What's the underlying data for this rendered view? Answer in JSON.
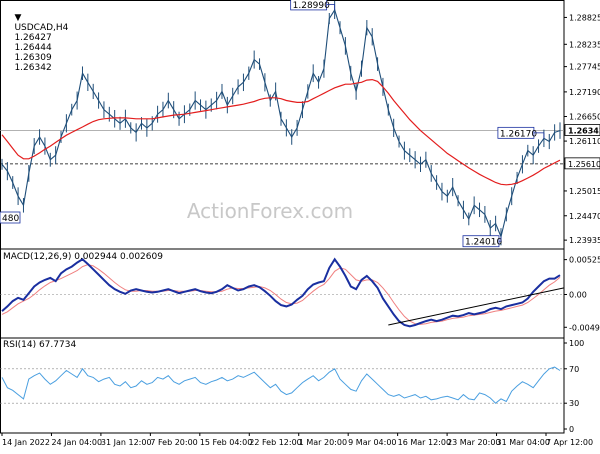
{
  "chart_data": {
    "type": "line",
    "symbol": "USDCAD,H4",
    "ohlc": {
      "open": "1.26427",
      "high": "1.26444",
      "low": "1.26309",
      "close": "1.26342"
    },
    "watermark": "ActionForex.com",
    "colors": {
      "price": "#1f4e79",
      "ma": "#e31e1e",
      "macd": "#1a2fa0",
      "signal": "#f08080",
      "rsi": "#4a9fe0",
      "trendline": "#000000",
      "guide": "#999999"
    },
    "price_panel": {
      "ylim": [
        1.2385,
        1.2912
      ],
      "y_ticks": [
        "1.28825",
        "1.28235",
        "1.27745",
        "1.27190",
        "1.26650",
        "1.26110",
        "1.25610",
        "1.25015",
        "1.24470",
        "1.23935"
      ],
      "current_price": "1.26342",
      "dashed_level": "1.25610",
      "left_partial_label": "480",
      "annotations": [
        {
          "label": "1.28990",
          "value": 1.2899
        },
        {
          "label": "1.26170",
          "value": 1.2617
        },
        {
          "label": "1.24010",
          "value": 1.2401
        }
      ],
      "close": [
        1.256,
        1.2545,
        1.252,
        1.249,
        1.247,
        1.254,
        1.26,
        1.262,
        1.26,
        1.257,
        1.258,
        1.262,
        1.265,
        1.268,
        1.27,
        1.276,
        1.274,
        1.272,
        1.27,
        1.268,
        1.267,
        1.266,
        1.265,
        1.266,
        1.264,
        1.263,
        1.265,
        1.264,
        1.265,
        1.267,
        1.268,
        1.27,
        1.268,
        1.266,
        1.267,
        1.268,
        1.27,
        1.269,
        1.268,
        1.269,
        1.27,
        1.272,
        1.269,
        1.271,
        1.273,
        1.274,
        1.276,
        1.279,
        1.278,
        1.274,
        1.27,
        1.272,
        1.266,
        1.264,
        1.262,
        1.264,
        1.268,
        1.272,
        1.276,
        1.274,
        1.277,
        1.288,
        1.2899,
        1.286,
        1.282,
        1.276,
        1.272,
        1.277,
        1.286,
        1.284,
        1.278,
        1.273,
        1.268,
        1.264,
        1.261,
        1.259,
        1.258,
        1.257,
        1.256,
        1.257,
        1.254,
        1.252,
        1.25,
        1.249,
        1.251,
        1.248,
        1.246,
        1.244,
        1.247,
        1.246,
        1.245,
        1.242,
        1.243,
        1.2401,
        1.245,
        1.249,
        1.253,
        1.256,
        1.259,
        1.258,
        1.26,
        1.2617,
        1.261,
        1.263,
        1.2634
      ],
      "ma": [
        1.2625,
        1.261,
        1.2595,
        1.258,
        1.2572,
        1.2572,
        1.2578,
        1.2585,
        1.2593,
        1.26,
        1.2608,
        1.2616,
        1.2624,
        1.263,
        1.2636,
        1.2642,
        1.2648,
        1.2654,
        1.2658,
        1.266,
        1.2661,
        1.2662,
        1.2662,
        1.2662,
        1.2661,
        1.266,
        1.266,
        1.266,
        1.266,
        1.2662,
        1.2664,
        1.2666,
        1.2668,
        1.2669,
        1.267,
        1.2672,
        1.2674,
        1.2676,
        1.2678,
        1.268,
        1.2682,
        1.2684,
        1.2686,
        1.2688,
        1.269,
        1.2692,
        1.2695,
        1.2698,
        1.2702,
        1.2705,
        1.2706,
        1.2706,
        1.2704,
        1.27,
        1.2698,
        1.2696,
        1.2696,
        1.2698,
        1.2704,
        1.271,
        1.2716,
        1.2722,
        1.2728,
        1.2732,
        1.2736,
        1.2736,
        1.2738,
        1.274,
        1.2745,
        1.2746,
        1.2742,
        1.273,
        1.2716,
        1.27,
        1.2686,
        1.2672,
        1.2658,
        1.2646,
        1.2634,
        1.2624,
        1.2614,
        1.2604,
        1.2594,
        1.2584,
        1.2576,
        1.2568,
        1.256,
        1.2552,
        1.2545,
        1.2538,
        1.2532,
        1.2526,
        1.252,
        1.2516,
        1.2515,
        1.2516,
        1.2519,
        1.2524,
        1.253,
        1.2536,
        1.2543,
        1.2551,
        1.2557,
        1.2563,
        1.2569
      ]
    },
    "macd_panel": {
      "label": "MACD(12,26,9) 0.002944 0.002609",
      "ylim": [
        -0.0058,
        0.0061
      ],
      "y_ticks": [
        "0.005253",
        "0.00",
        "-0.004939"
      ],
      "macd": [
        -0.0025,
        -0.0018,
        -0.001,
        -0.0005,
        -0.0008,
        0.0002,
        0.0012,
        0.0018,
        0.0022,
        0.0025,
        0.002,
        0.0032,
        0.0038,
        0.0042,
        0.0048,
        0.0053,
        0.0046,
        0.0038,
        0.003,
        0.0022,
        0.0014,
        0.0008,
        0.0004,
        0.0001,
        0.0006,
        0.0008,
        0.0006,
        0.0004,
        0.0003,
        0.0004,
        0.0006,
        0.0008,
        0.0005,
        0.0002,
        0.0004,
        0.0006,
        0.0008,
        0.0005,
        0.0003,
        0.0002,
        0.0004,
        0.0008,
        0.0014,
        0.001,
        0.0006,
        0.0008,
        0.0012,
        0.0014,
        0.0011,
        0.0005,
        -0.0002,
        -0.001,
        -0.0016,
        -0.0018,
        -0.0015,
        -0.0008,
        -0.0002,
        0.0008,
        0.0015,
        0.0018,
        0.002,
        0.004,
        0.0053,
        0.0042,
        0.0028,
        0.0012,
        0.0008,
        0.0022,
        0.0028,
        0.002,
        0.001,
        -0.0006,
        -0.0018,
        -0.003,
        -0.004,
        -0.0046,
        -0.0048,
        -0.0046,
        -0.0043,
        -0.004,
        -0.0038,
        -0.004,
        -0.0038,
        -0.0035,
        -0.0032,
        -0.0033,
        -0.0031,
        -0.0028,
        -0.003,
        -0.0028,
        -0.0026,
        -0.0022,
        -0.002,
        -0.0022,
        -0.0018,
        -0.0016,
        -0.0014,
        -0.0012,
        -0.0006,
        0.0004,
        0.0012,
        0.002,
        0.0024,
        0.0024,
        0.0029
      ],
      "signal": [
        -0.003,
        -0.0026,
        -0.002,
        -0.0014,
        -0.001,
        -0.0006,
        0.0,
        0.0007,
        0.0013,
        0.0018,
        0.0021,
        0.0024,
        0.0028,
        0.0032,
        0.0036,
        0.0042,
        0.0045,
        0.0043,
        0.0038,
        0.0032,
        0.0025,
        0.0018,
        0.0012,
        0.0007,
        0.0005,
        0.0005,
        0.0006,
        0.0006,
        0.0005,
        0.0005,
        0.0005,
        0.0006,
        0.0006,
        0.0005,
        0.0005,
        0.0005,
        0.0006,
        0.0006,
        0.0005,
        0.0004,
        0.0004,
        0.0005,
        0.0008,
        0.001,
        0.0009,
        0.0009,
        0.001,
        0.0011,
        0.0012,
        0.001,
        0.0006,
        0.0,
        -0.0007,
        -0.0012,
        -0.0014,
        -0.0013,
        -0.0009,
        -0.0002,
        0.0005,
        0.0011,
        0.0015,
        0.0024,
        0.0035,
        0.004,
        0.0038,
        0.003,
        0.0022,
        0.002,
        0.0022,
        0.0022,
        0.0018,
        0.001,
        0.0,
        -0.0012,
        -0.0023,
        -0.0033,
        -0.004,
        -0.0044,
        -0.0045,
        -0.0044,
        -0.0042,
        -0.0041,
        -0.004,
        -0.0038,
        -0.0036,
        -0.0035,
        -0.0034,
        -0.0032,
        -0.0031,
        -0.003,
        -0.0029,
        -0.0027,
        -0.0025,
        -0.0024,
        -0.0022,
        -0.002,
        -0.0018,
        -0.0016,
        -0.0012,
        -0.0006,
        0.0,
        0.0007,
        0.0014,
        0.0019,
        0.0026
      ]
    },
    "rsi_panel": {
      "label": "RSI(14) 67.7734",
      "ylim": [
        0,
        100
      ],
      "y_ticks": [
        "100",
        "70",
        "30",
        "0"
      ],
      "levels": [
        70,
        30
      ],
      "rsi": [
        60,
        48,
        45,
        40,
        35,
        58,
        62,
        65,
        58,
        52,
        56,
        62,
        68,
        64,
        60,
        70,
        62,
        60,
        55,
        58,
        60,
        52,
        50,
        55,
        48,
        50,
        56,
        52,
        54,
        60,
        58,
        62,
        55,
        52,
        56,
        58,
        60,
        54,
        52,
        55,
        57,
        60,
        56,
        58,
        62,
        60,
        63,
        66,
        60,
        54,
        48,
        52,
        44,
        40,
        42,
        48,
        54,
        58,
        62,
        56,
        60,
        66,
        70,
        58,
        52,
        46,
        44,
        56,
        64,
        58,
        52,
        46,
        40,
        38,
        40,
        36,
        38,
        40,
        36,
        38,
        34,
        35,
        37,
        38,
        36,
        34,
        40,
        35,
        34,
        42,
        40,
        36,
        30,
        35,
        32,
        44,
        50,
        55,
        52,
        48,
        56,
        64,
        70,
        72,
        68
      ]
    },
    "x_labels": [
      "14 Jan 2022",
      "24 Jan 04:00",
      "31 Jan 12:00",
      "7 Feb 20:00",
      "15 Feb 04:00",
      "22 Feb 12:00",
      "1 Mar 20:00",
      "9 Mar 04:00",
      "16 Mar 12:00",
      "23 Mar 20:00",
      "31 Mar 04:00",
      "7 Apr 12:00"
    ]
  }
}
